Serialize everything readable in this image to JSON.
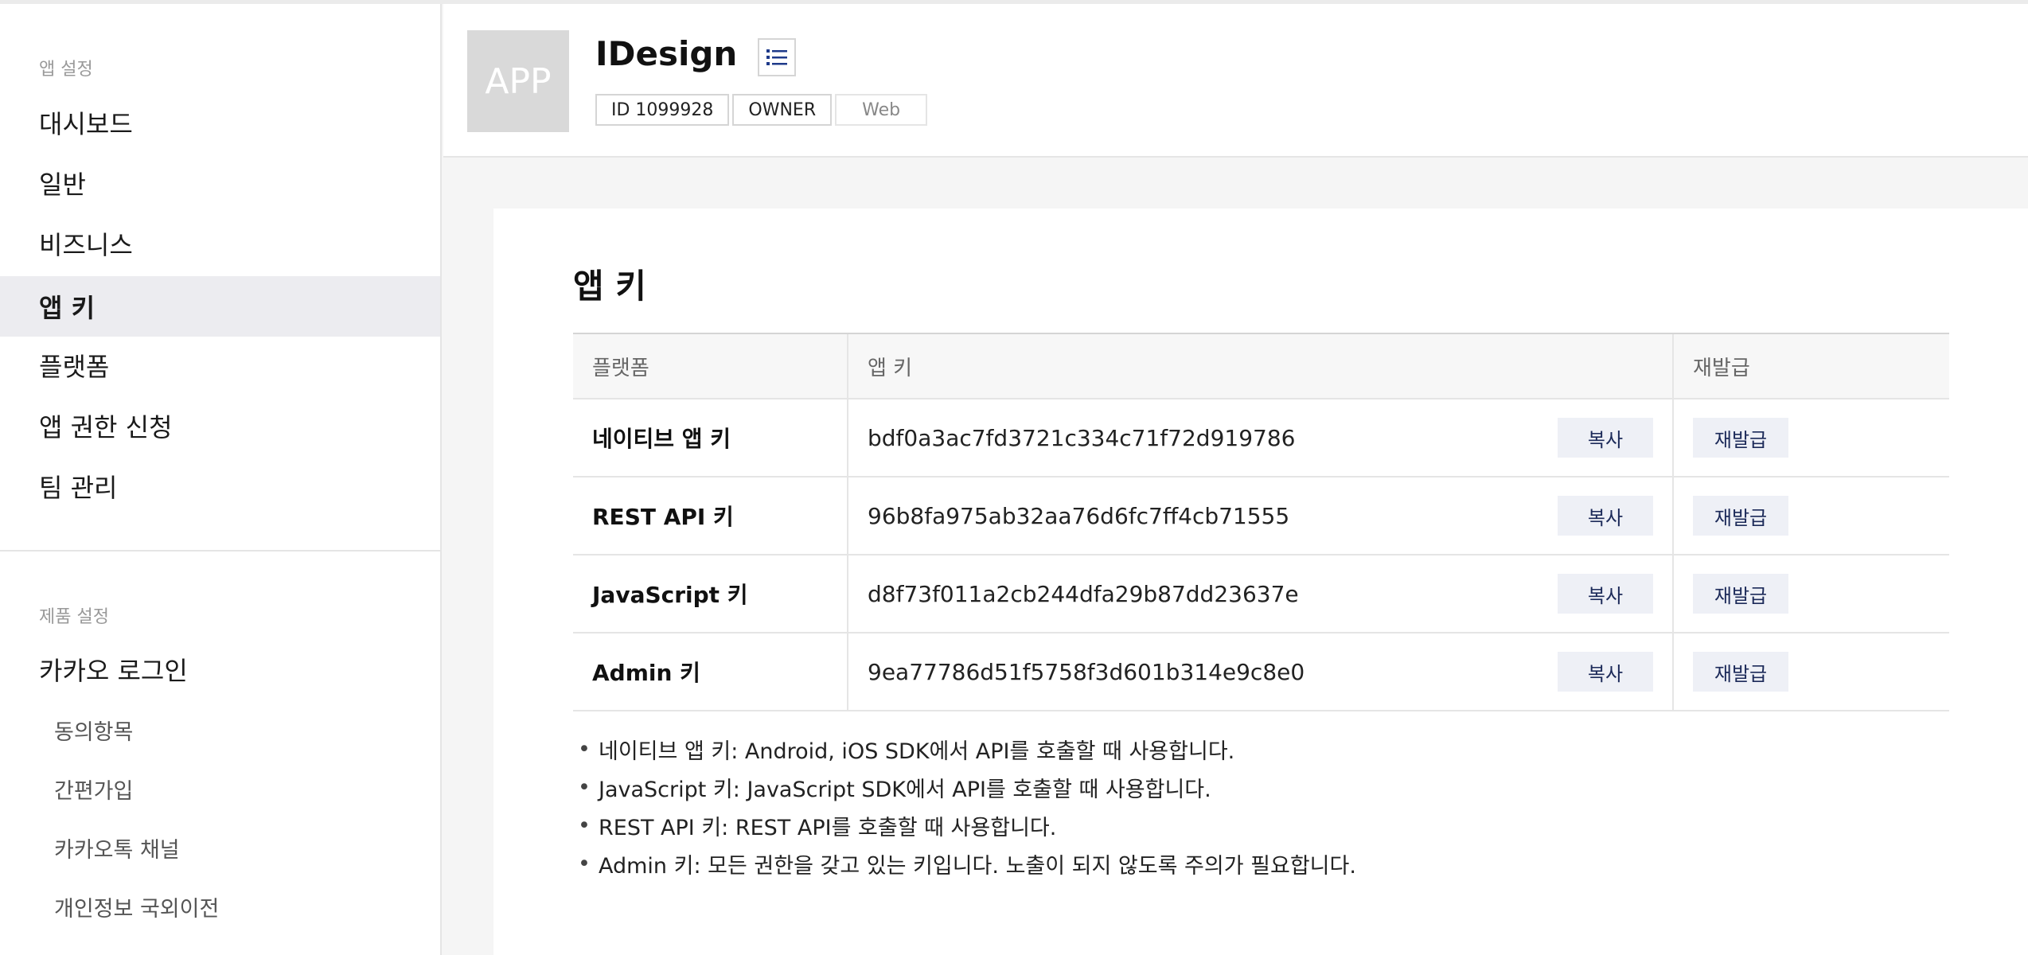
{
  "sidebar": {
    "app_settings_label": "앱 설정",
    "items": [
      {
        "label": "대시보드"
      },
      {
        "label": "일반"
      },
      {
        "label": "비즈니스"
      },
      {
        "label": "앱 키"
      },
      {
        "label": "플랫폼"
      },
      {
        "label": "앱 권한 신청"
      },
      {
        "label": "팀 관리"
      }
    ],
    "active_item": "앱 키",
    "product_settings_label": "제품 설정",
    "product_item": "카카오 로그인",
    "sub_items": [
      {
        "label": "동의항목"
      },
      {
        "label": "간편가입"
      },
      {
        "label": "카카오톡 채널"
      },
      {
        "label": "개인정보 국외이전"
      }
    ]
  },
  "header": {
    "thumb_text": "APP",
    "app_name": "IDesign",
    "list_icon": "list-icon",
    "badges": [
      "ID 1099928",
      "OWNER",
      "Web"
    ]
  },
  "main": {
    "title": "앱 키",
    "table": {
      "headers": [
        "플랫폼",
        "앱 키",
        "재발급"
      ],
      "rows": [
        {
          "platform": "네이티브 앱 키",
          "key": "bdf0a3ac7fd3721c334c71f72d919786",
          "copy": "복사",
          "reissue": "재발급"
        },
        {
          "platform": "REST API 키",
          "key": "96b8fa975ab32aa76d6fc7ff4cb71555",
          "copy": "복사",
          "reissue": "재발급"
        },
        {
          "platform": "JavaScript 키",
          "key": "d8f73f011a2cb244dfa29b87dd23637e",
          "copy": "복사",
          "reissue": "재발급"
        },
        {
          "platform": "Admin 키",
          "key": "9ea77786d51f5758f3d601b314e9c8e0",
          "copy": "복사",
          "reissue": "재발급"
        }
      ]
    },
    "bullet": "•",
    "notes": [
      "네이티브 앱 키: Android, iOS SDK에서 API를 호출할 때 사용합니다.",
      "JavaScript 키: JavaScript SDK에서 API를 호출할 때 사용합니다.",
      "REST API 키: REST API를 호출할 때 사용합니다.",
      "Admin 키: 모든 권한을 갖고 있는 키입니다. 노출이 되지 않도록 주의가 필요합니다."
    ]
  },
  "colors": {
    "active_bg": "#ececf0",
    "button_bg": "#eef0f6",
    "button_text": "#1c2a59",
    "icon_blue": "#1e3a8a"
  }
}
